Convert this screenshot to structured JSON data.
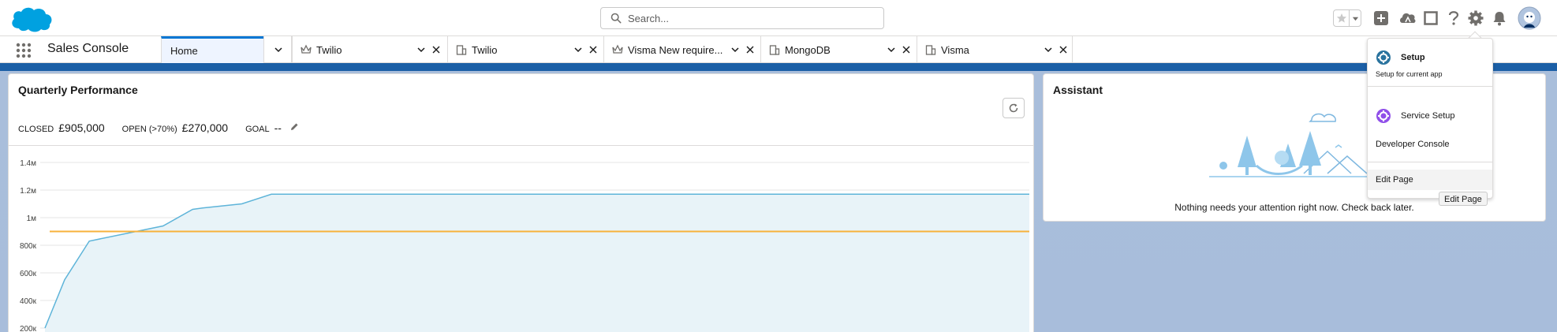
{
  "header": {
    "search_placeholder": "Search...",
    "brand_color": "#00a1e0",
    "icons": [
      "favorites-star-icon",
      "favorites-dropdown-icon",
      "global-actions-add-icon",
      "trailhead-icon",
      "split-view-icon",
      "help-icon",
      "setup-gear-icon",
      "notifications-bell-icon",
      "user-avatar"
    ]
  },
  "context": {
    "app_name": "Sales Console",
    "tabs": [
      {
        "label": "Home",
        "icon": "none",
        "active": true
      },
      {
        "label": "Twilio",
        "icon": "opportunity-crown-icon"
      },
      {
        "label": "Twilio",
        "icon": "account-building-icon"
      },
      {
        "label": "Visma New require...",
        "icon": "opportunity-crown-icon"
      },
      {
        "label": "MongoDB",
        "icon": "account-building-icon"
      },
      {
        "label": "Visma",
        "icon": "account-building-icon"
      }
    ]
  },
  "performance": {
    "title": "Quarterly Performance",
    "closed_label": "CLOSED",
    "closed_value": "£905,000",
    "open_label": "OPEN (>70%)",
    "open_value": "£270,000",
    "goal_label": "GOAL",
    "goal_value": "--"
  },
  "chart_data": {
    "type": "area",
    "title": "",
    "xlabel": "",
    "ylabel": "",
    "y_tick_labels": [
      "1.4м",
      "1.2м",
      "1м",
      "800к",
      "600к",
      "400к",
      "200к"
    ],
    "y_tick_values": [
      1400000,
      1200000,
      1000000,
      800000,
      600000,
      400000,
      200000
    ],
    "ylim": [
      200000,
      1400000
    ],
    "xlim": [
      0,
      100
    ],
    "grid": true,
    "series": [
      {
        "color": "#5eb4d9",
        "x": [
          0,
          2,
          4.5,
          12,
          15,
          16,
          20,
          23,
          100
        ],
        "y": [
          200000,
          550000,
          830000,
          940000,
          1060000,
          1070000,
          1100000,
          1170000,
          1170000
        ]
      }
    ],
    "reference_line": {
      "value": 900000,
      "color": "#f7b23b"
    }
  },
  "assistant": {
    "title": "Assistant",
    "empty_message": "Nothing needs your attention right now. Check back later."
  },
  "setup_menu": {
    "setup_title": "Setup",
    "setup_subtitle": "Setup for current app",
    "service_setup": "Service Setup",
    "developer_console": "Developer Console",
    "edit_page": "Edit Page",
    "tooltip": "Edit Page"
  }
}
